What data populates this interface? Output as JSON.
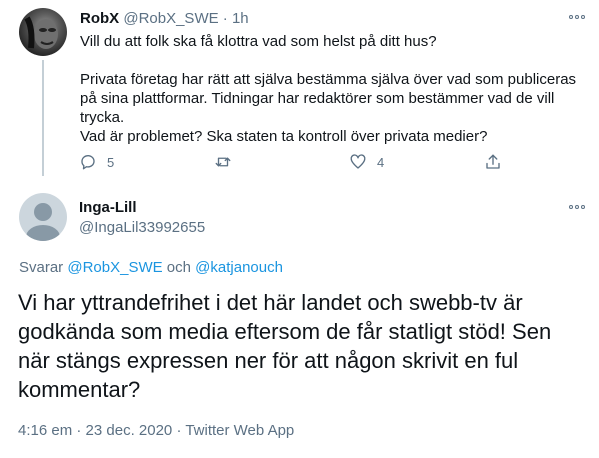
{
  "tweet1": {
    "name": "RobX",
    "handle": "@RobX_SWE",
    "sep": "·",
    "time": "1h",
    "lines": [
      "Vill du att folk ska få klottra vad som helst på ditt hus?",
      "Privata företag har rätt att själva bestämma själva över vad som publiceras",
      "på sina plattformar. Tidningar har redaktörer som bestämmer vad de vill",
      "trycka.",
      "Vad är problemet? Ska staten ta kontroll över privata medier?"
    ],
    "reply_count": "5",
    "like_count": "4",
    "icons": [
      "reply-icon",
      "retweet-icon",
      "like-icon",
      "share-icon",
      "more-icon"
    ]
  },
  "tweet2": {
    "name": "Inga-Lill",
    "handle": "@IngaLil33992655",
    "replying_prefix": "Svarar",
    "replying_user1": "@RobX_SWE",
    "replying_and": "och",
    "replying_user2": "@katjanouch",
    "text": "Vi har yttrandefrihet i det här landet och swebb-tv är godkända som media eftersom de får statligt stöd! Sen när stängs expressen ner för att någon skrivit en ful kommentar?",
    "timestamp": "4:16 em · 23 dec. 2020 · Twitter Web App"
  },
  "colors": {
    "link": "#1b95e0",
    "muted": "#5b7083",
    "text": "#0f1419"
  }
}
